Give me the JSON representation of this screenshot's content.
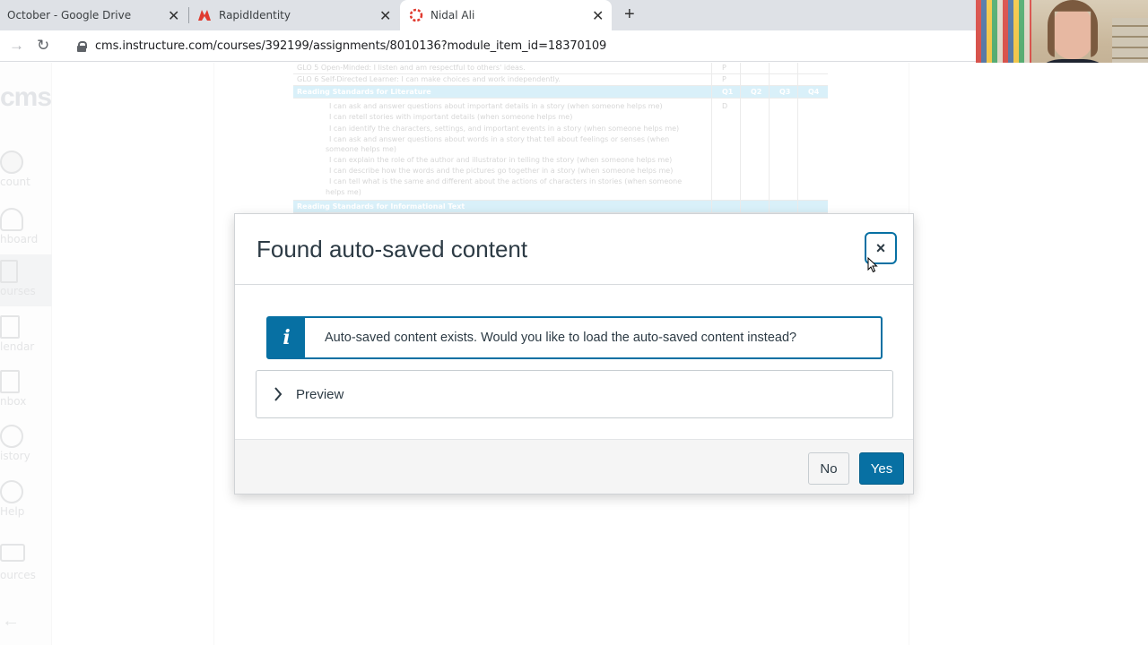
{
  "browser": {
    "tabs": [
      {
        "title": "October - Google Drive",
        "icon": "google-drive-icon"
      },
      {
        "title": "RapidIdentity",
        "icon": "rapididentity-icon"
      },
      {
        "title": "Nidal Ali",
        "icon": "canvas-icon",
        "active": true
      }
    ],
    "url": "cms.instructure.com/courses/392199/assignments/8010136?module_item_id=18370109"
  },
  "lms_nav": {
    "logo": "cms",
    "items": [
      {
        "label": "count"
      },
      {
        "label": "hboard"
      },
      {
        "label": "ourses",
        "active": true
      },
      {
        "label": "lendar"
      },
      {
        "label": "nbox"
      },
      {
        "label": "istory"
      },
      {
        "label": "Help"
      },
      {
        "label": "ources"
      }
    ]
  },
  "document": {
    "rows": [
      "GLO 5  Open-Minded: I listen and am respectful to others' ideas.",
      "GLO 6  Self-Directed Learner: I can make choices and work independently.",
      "Reading Standards for Literature",
      "I can ask and answer questions about important details in a story (when someone helps me)",
      "I can retell stories with important details (when someone helps me)",
      "I can identify the characters, settings, and important events in a story (when someone helps me)",
      "I can ask and answer questions about words in a story that tell about feelings or senses (when",
      "someone helps me)",
      "I can explain the role of the author and illustrator in telling the story (when someone helps me)",
      "I can describe how the words and the pictures go together in a story (when someone helps me)",
      "I can tell what is the same and different about the actions of characters in stories (when someone",
      "helps me)",
      "Reading Standards for Informational Text"
    ],
    "quarters": [
      "Q1",
      "Q2",
      "Q3",
      "Q4"
    ],
    "marks": [
      "P",
      "P",
      "D"
    ]
  },
  "modal": {
    "title": "Found auto-saved content",
    "close_label": "×",
    "alert_icon": "i",
    "alert_text": "Auto-saved content exists. Would you like to load the auto-saved content instead?",
    "preview_label": "Preview",
    "no_label": "No",
    "yes_label": "Yes"
  },
  "colors": {
    "primary": "#0770a3",
    "text": "#2d3b45",
    "table_header": "#3ab3e0"
  }
}
